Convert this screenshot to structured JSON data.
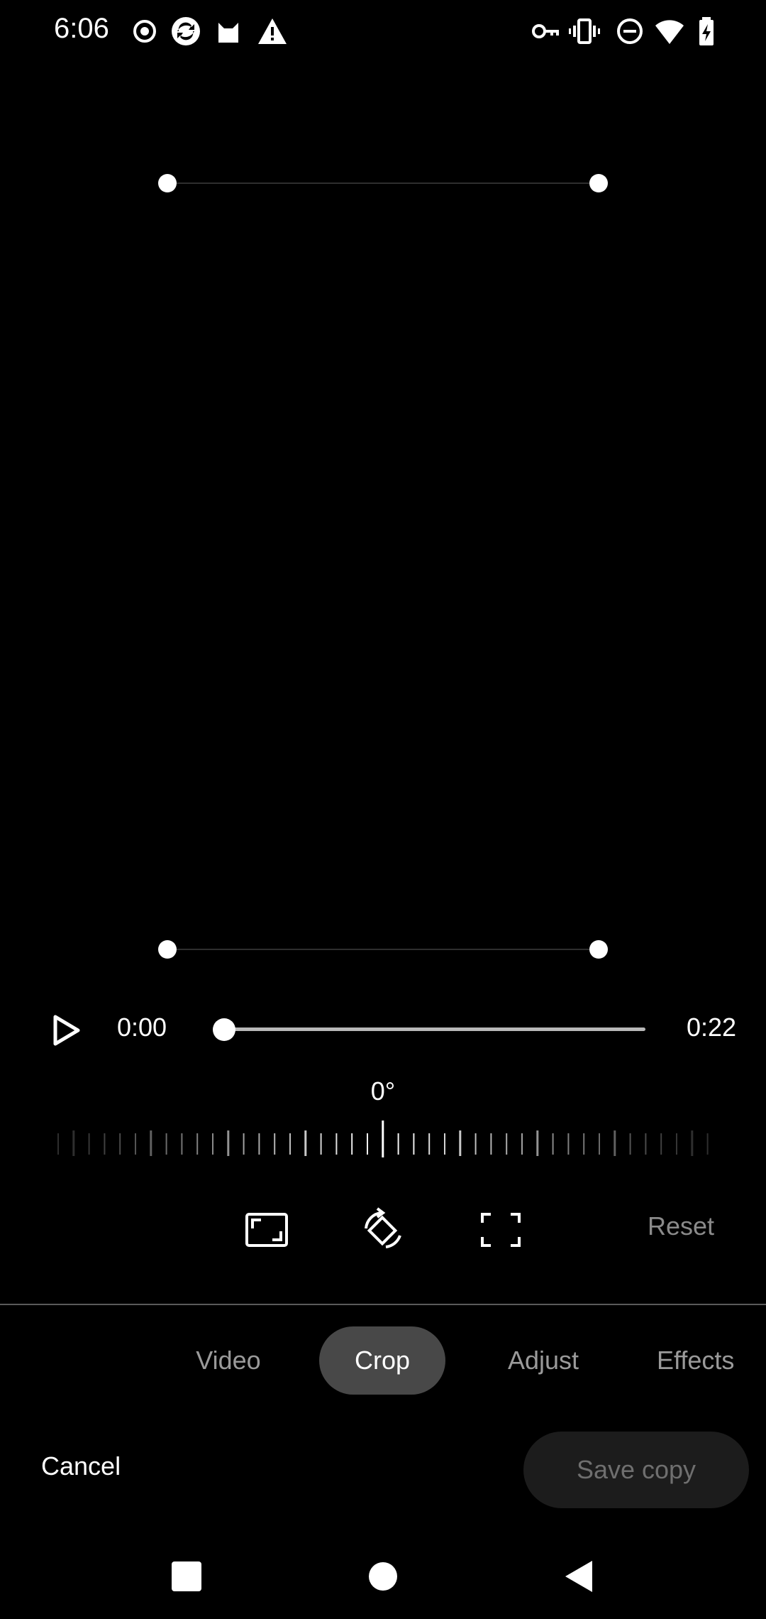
{
  "status_bar": {
    "time": "6:06",
    "left_icons": [
      "record-icon",
      "app-icon",
      "cat-icon",
      "warning-icon"
    ],
    "right_icons": [
      "key-icon",
      "vibrate-icon",
      "dnd-icon",
      "wifi-icon",
      "battery-charging-icon"
    ]
  },
  "playback": {
    "current_time": "0:00",
    "duration": "0:22",
    "progress": 0.0
  },
  "rotation": {
    "angle_label": "0°"
  },
  "tools": {
    "aspect_ratio_icon": "aspect-ratio-icon",
    "rotate_icon": "rotate-icon",
    "free_crop_icon": "crop-free-icon",
    "reset_label": "Reset"
  },
  "tabs": [
    {
      "label": "Video",
      "active": false
    },
    {
      "label": "Crop",
      "active": true
    },
    {
      "label": "Adjust",
      "active": false
    },
    {
      "label": "Effects",
      "active": false
    }
  ],
  "actions": {
    "cancel_label": "Cancel",
    "save_label": "Save copy"
  },
  "nav": {
    "recents_icon": "recents-icon",
    "home_icon": "home-icon",
    "back_icon": "back-icon"
  }
}
